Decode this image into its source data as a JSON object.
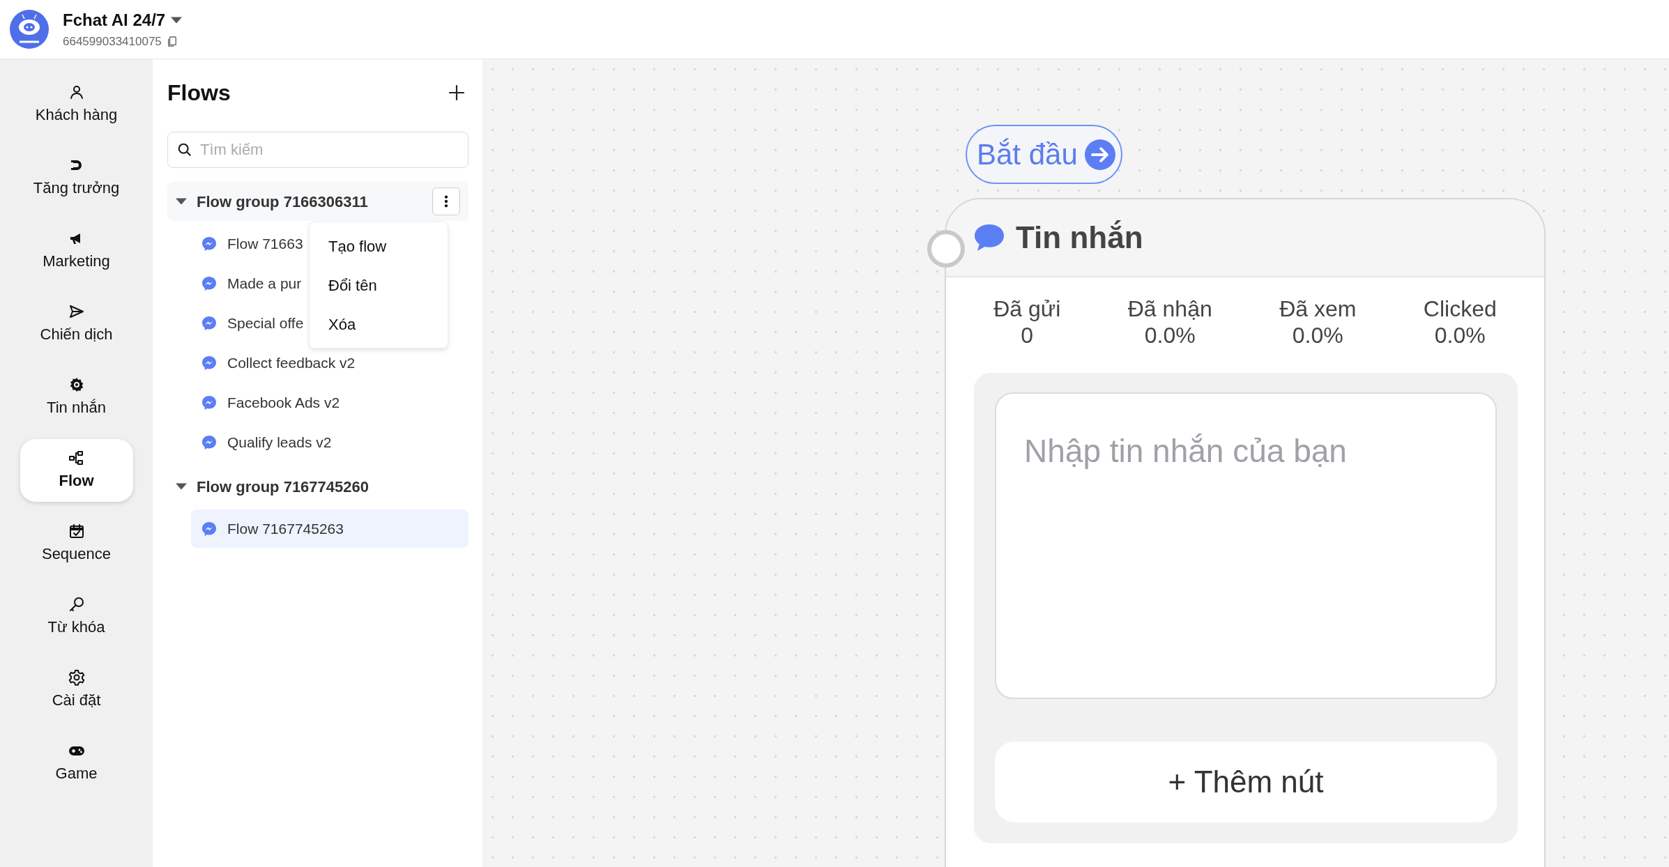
{
  "app": {
    "name": "Fchat AI 24/7",
    "page_id": "664599033410075"
  },
  "nav": [
    {
      "label": "Khách hàng",
      "kind": "person",
      "selected": false
    },
    {
      "label": "Tăng trưởng",
      "kind": "magnet",
      "selected": false
    },
    {
      "label": "Marketing",
      "kind": "megaphone",
      "selected": false
    },
    {
      "label": "Chiến dịch",
      "kind": "send",
      "selected": false
    },
    {
      "label": "Tin nhắn",
      "kind": "cog",
      "selected": false
    },
    {
      "label": "Flow",
      "kind": "flow",
      "selected": true
    },
    {
      "label": "Sequence",
      "kind": "calendar",
      "selected": false
    },
    {
      "label": "Từ khóa",
      "kind": "key",
      "selected": false
    },
    {
      "label": "Cài đặt",
      "kind": "gear",
      "selected": false
    },
    {
      "label": "Game",
      "kind": "gamepad",
      "selected": false
    }
  ],
  "flows_panel": {
    "title": "Flows",
    "search": {
      "placeholder": "Tìm kiếm"
    },
    "groups": [
      {
        "name": "Flow group 7166306311",
        "expanded": true,
        "hovered": true,
        "menu": [
          "Tạo flow",
          "Đổi tên",
          "Xóa"
        ],
        "children": [
          {
            "label": "Flow 71663",
            "selected": false
          },
          {
            "label": "Made a pur",
            "selected": false
          },
          {
            "label": "Special offe",
            "selected": false
          },
          {
            "label": "Collect feedback v2",
            "selected": false
          },
          {
            "label": "Facebook Ads v2",
            "selected": false
          },
          {
            "label": "Qualify leads v2",
            "selected": false
          }
        ]
      },
      {
        "name": "Flow group 7167745260",
        "expanded": true,
        "hovered": false,
        "children": [
          {
            "label": "Flow 7167745263",
            "selected": true
          }
        ]
      }
    ]
  },
  "canvas": {
    "start": {
      "label": "Bắt đầu"
    },
    "node": {
      "title": "Tin nhắn",
      "stats": [
        {
          "label": "Đã gửi",
          "value": "0"
        },
        {
          "label": "Đã nhận",
          "value": "0.0%"
        },
        {
          "label": "Đã xem",
          "value": "0.0%"
        },
        {
          "label": "Clicked",
          "value": "0.0%"
        }
      ],
      "message": {
        "placeholder": "Nhập tin nhắn của bạn"
      },
      "add_button": "+ Thêm nút"
    }
  }
}
